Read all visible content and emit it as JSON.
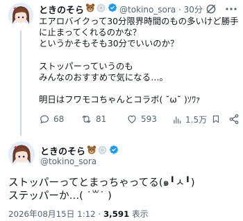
{
  "tweet1": {
    "display_name": "ときのそら",
    "handle_meta": "@tokino_sora · 30分",
    "body_lines": [
      "エアロバイクって30分限界時間のもの多いけど勝手",
      "に止まってくれるのかな？",
      "というかそもそも30分でいいのか？",
      "",
      "ストッパーっていうのも",
      "みんなのおすすめで気になる…。",
      "",
      "明日はフワモコちゃんとコラボ( ˘ω˘ )ｿﾜｧ"
    ],
    "replies": "68",
    "reposts": "81",
    "likes": "593",
    "views": "1.5万"
  },
  "tweet2": {
    "display_name": "ときのそら",
    "handle": "@tokino_sora",
    "body_lines": [
      "ストッパーってとまっちゃってる(๑╹ㅅ╹)",
      "ステッパーか…( ˙꒳˙ )"
    ],
    "timestamp": "2026年08月15日 1:12 · ",
    "views_count": "3,591",
    "views_label": " 表示"
  },
  "colors": {
    "text": "#0f1419",
    "secondary": "#536471",
    "verified": "#1d9bf0",
    "thread_line": "#cfd9de"
  }
}
